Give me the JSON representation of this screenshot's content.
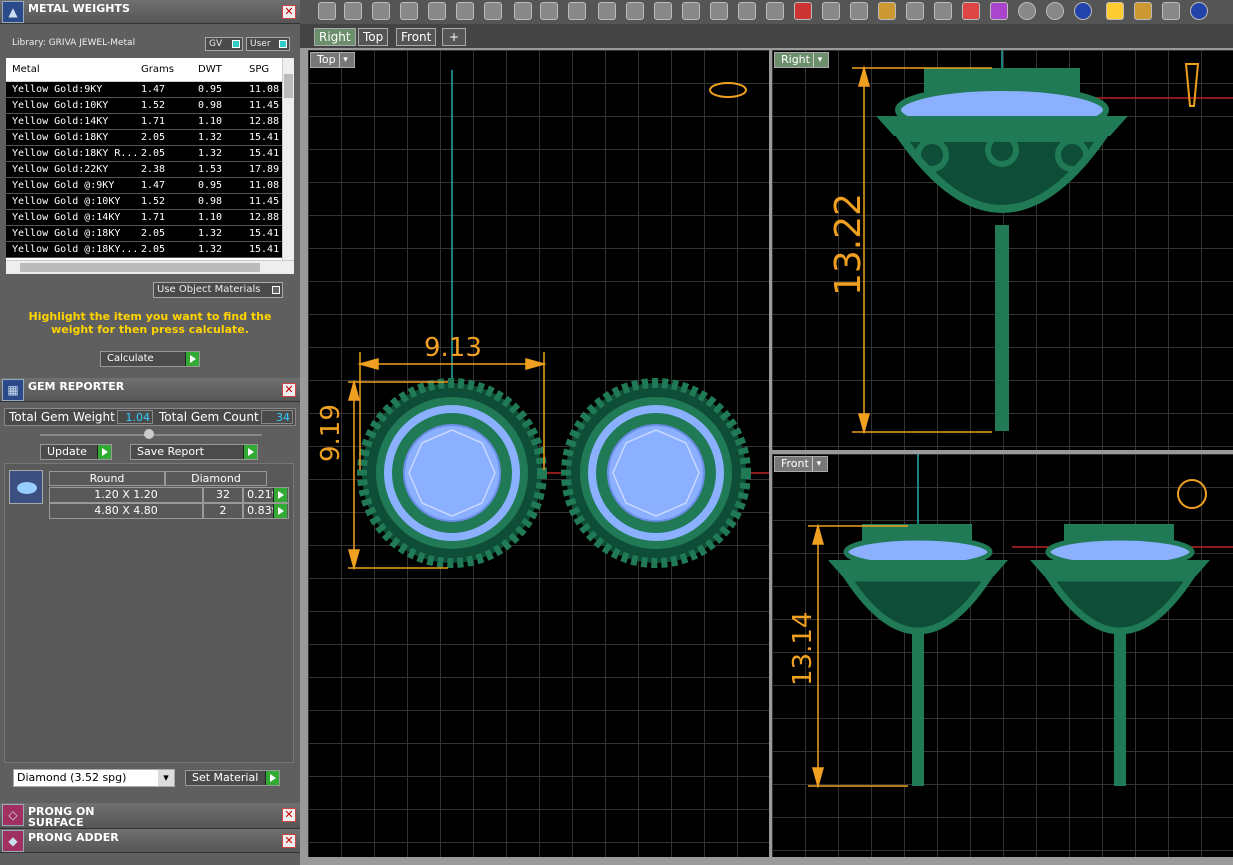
{
  "metal_weights": {
    "title": "METAL WEIGHTS",
    "library": "Library: GRIVA JEWEL-Metal",
    "gv": "GV",
    "user": "User",
    "columns": [
      "Metal",
      "Grams",
      "DWT",
      "SPG"
    ],
    "rows": [
      [
        "Yellow Gold:9KY",
        "1.47",
        "0.95",
        "11.08"
      ],
      [
        "Yellow Gold:10KY",
        "1.52",
        "0.98",
        "11.45"
      ],
      [
        "Yellow Gold:14KY",
        "1.71",
        "1.10",
        "12.88"
      ],
      [
        "Yellow Gold:18KY",
        "2.05",
        "1.32",
        "15.41"
      ],
      [
        "Yellow Gold:18KY R...",
        "2.05",
        "1.32",
        "15.41"
      ],
      [
        "Yellow Gold:22KY",
        "2.38",
        "1.53",
        "17.89"
      ],
      [
        "Yellow Gold @:9KY",
        "1.47",
        "0.95",
        "11.08"
      ],
      [
        "Yellow Gold @:10KY",
        "1.52",
        "0.98",
        "11.45"
      ],
      [
        "Yellow Gold @:14KY",
        "1.71",
        "1.10",
        "12.88"
      ],
      [
        "Yellow Gold @:18KY",
        "2.05",
        "1.32",
        "15.41"
      ],
      [
        "Yellow Gold @:18KY...",
        "2.05",
        "1.32",
        "15.41"
      ]
    ],
    "use_object_materials": "Use Object Materials",
    "hint": "Highlight the item you want to find the weight for then press calculate.",
    "calculate": "Calculate"
  },
  "gem_reporter": {
    "title": "GEM REPORTER",
    "total_weight_label": "Total Gem Weight",
    "total_weight": "1.04",
    "total_count_label": "Total Gem Count",
    "total_count": "34",
    "update": "Update",
    "save_report": "Save Report",
    "columns": [
      "Round",
      "Diamond"
    ],
    "gems": [
      {
        "size": "1.20 X 1.20",
        "count": "32",
        "tw": "0.21tw"
      },
      {
        "size": "4.80 X 4.80",
        "count": "2",
        "tw": "0.83tw"
      }
    ],
    "material_select": "Diamond    (3.52 spg)",
    "set_material": "Set Material"
  },
  "panels": {
    "prong_on_surface": "PRONG ON SURFACE",
    "prong_adder": "PRONG ADDER"
  },
  "tabs": [
    "Right",
    "Top",
    "Front",
    "+"
  ],
  "viewports": {
    "top": {
      "label": "Top",
      "dim_w": "9.13",
      "dim_h": "9.19"
    },
    "right": {
      "label": "Right",
      "dim_h": "13.22"
    },
    "front": {
      "label": "Front",
      "dim_h": "13.14"
    }
  },
  "colors": {
    "accent": "#f0a020",
    "model": "#1f7a55",
    "gem": "#8ab0ff"
  }
}
